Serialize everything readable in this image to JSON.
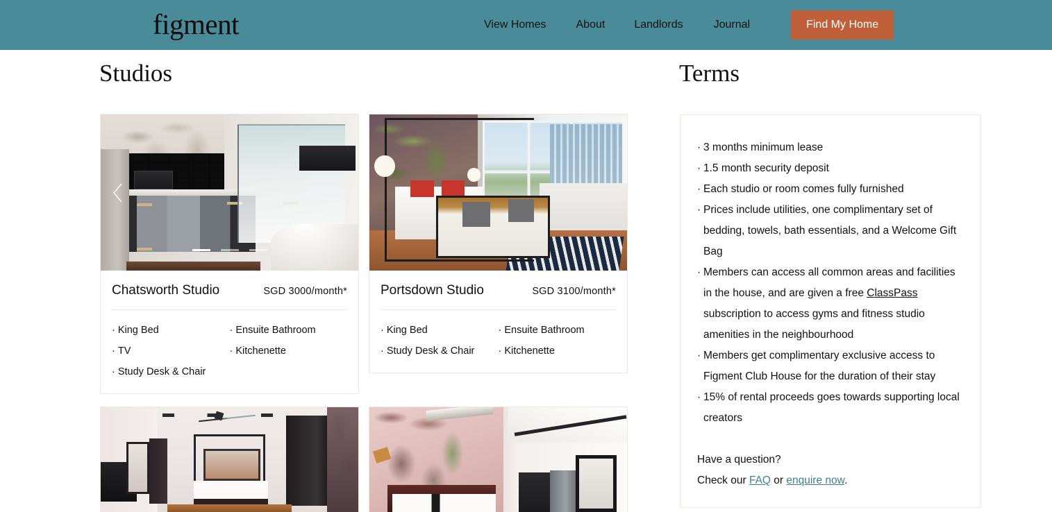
{
  "brand": {
    "logo_text": "figment",
    "header_bg": "#4a8b99",
    "cta_bg": "#c0603a",
    "link_color": "#3f7f93"
  },
  "nav": {
    "items": [
      {
        "label": "View Homes"
      },
      {
        "label": "About"
      },
      {
        "label": "Landlords"
      },
      {
        "label": "Journal"
      }
    ],
    "cta_label": "Find My Home"
  },
  "sections": {
    "studios_title": "Studios",
    "terms_title": "Terms"
  },
  "listings": [
    {
      "name": "Chatsworth Studio",
      "price": "SGD 3000/month*",
      "features_left": [
        "King Bed",
        "TV",
        "Study Desk & Chair"
      ],
      "features_right": [
        "Ensuite Bathroom",
        "Kitchenette"
      ],
      "photo_alt": "Studio kitchenette with black subway tile backsplash, grey cabinets, microwave, fridge, frosted glass partition, wall-mounted TV and bed",
      "carousel": {
        "prev_icon": "chevron-left-icon",
        "slide_count": 3,
        "active_slide": 1
      }
    },
    {
      "name": "Portsdown Studio",
      "price": "SGD 3100/month*",
      "features_left": [
        "King Bed",
        "Study Desk & Chair"
      ],
      "features_right": [
        "Ensuite Bathroom",
        "Kitchenette"
      ],
      "photo_alt": "Bedroom with tropical mural wallpaper, black canopy bed, rattan daybed, large windows overlooking high-rise towers, wood floor and navy striped rug"
    }
  ],
  "more_photos": [
    {
      "photo_alt": "Bedroom with ceiling fan, canopy bed facing a window, black wardrobe and wall-mounted TV"
    },
    {
      "photo_alt": "Bedroom with pink tropical mural, bed with white and black pillows, kitchenette with fridge and full-length mirror"
    }
  ],
  "bullet": "·",
  "terms": {
    "items": [
      {
        "text": "3 months minimum lease"
      },
      {
        "text": "1.5 month security deposit"
      },
      {
        "text": "Each studio or room comes fully furnished"
      },
      {
        "text": "Prices include utilities, one complimentary set of bedding, towels, bath essentials, and a Welcome Gift Bag"
      },
      {
        "text_before": "Members can access all common areas and facilities in the house, and are given a free ",
        "link": "ClassPass",
        "text_after": " subscription to access gyms and fitness studio amenities in the neighbourhood"
      },
      {
        "text": "Members get complimentary exclusive access to Figment Club House for the duration of their stay"
      },
      {
        "text": "15% of rental proceeds goes towards supporting local creators"
      }
    ],
    "question_heading": "Have a question?",
    "check_prefix": "Check our ",
    "faq_link": "FAQ",
    "or_text": " or ",
    "enquire_link": "enquire now",
    "period": "."
  }
}
